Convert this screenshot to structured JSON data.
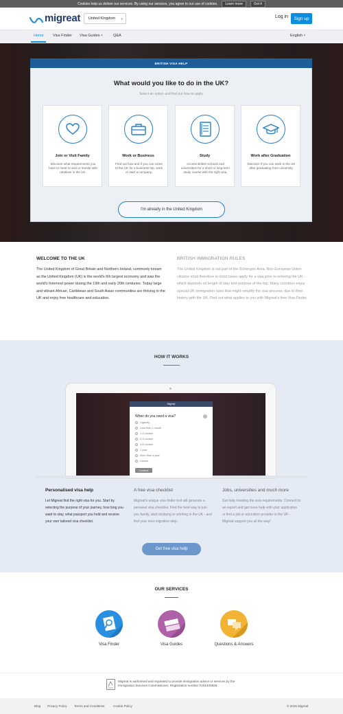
{
  "cookie": {
    "text": "Cookies help us deliver our services. By using our services, you agree to our use of cookies.",
    "learn": "Learn more",
    "gotit": "Got it"
  },
  "header": {
    "logo": "migreat",
    "country": "United Kingdom",
    "login": "Log in",
    "signup": "Sign up"
  },
  "nav": {
    "items": [
      "Home",
      "Visa Finder",
      "Visa Guides",
      "Q&A"
    ],
    "language": "English"
  },
  "hero": {
    "banner": "BRITISH VISA HELP",
    "title": "What would you like to do in the UK?",
    "subtitle": "Select an option and find out how to apply",
    "options": [
      {
        "icon": "heart-icon",
        "title": "Join or Visit Family",
        "desc": "Discover what requirements you have to meet to visit or reunite with relatives in the UK."
      },
      {
        "icon": "briefcase-icon",
        "title": "Work or Business",
        "desc": "Find out how and if you can come to the UK for a business trip, work or start a company."
      },
      {
        "icon": "notebook-icon",
        "title": "Study",
        "desc": "Access British schools and universities for a short or long-term study course with the right visa."
      },
      {
        "icon": "graduation-cap-icon",
        "title": "Work after Graduation",
        "desc": "Discover if you can work in the UK after graduating from university."
      }
    ],
    "already": "I'm already in the United Kingdom"
  },
  "welcome": {
    "title": "WELCOME TO THE UK",
    "text": "The United Kingdom of Great Britain and Northern Ireland, commonly known as the United Kingdom (UK) is the world's 6th largest economy and was the world's foremost power during the 19th and early 20th centuries. Today large and vibrant African, Caribbean and South Asian communities are thriving in the UK and enjoy free healthcare and education."
  },
  "rules": {
    "title": "BRITISH IMMIGRATION RULES",
    "text": "The United Kingdom is not part of the Schengen Area. Non-European Union citizens must therefore in most cases apply for a visa prior to entering the UK -which depends on length of stay and purpose of the trip. Many countries enjoy special UK immigration rules that might simplify the visa process, due to their history with the UK. Find out what applies to you with Migreat's free Visa Finder."
  },
  "how": {
    "title": "HOW IT WORKS",
    "modal": {
      "header": "Migreat",
      "question": "When do you need a visa?",
      "options": [
        "Urgently",
        "Less than 1 month",
        "1-2 months",
        "2-3 months",
        "3-6 months",
        "1 year",
        "More than a year",
        "Unsure"
      ],
      "button": "Continue"
    },
    "columns": [
      {
        "title": "Personalised visa help",
        "text": "Let Migreat find the right visa for you. Start by selecting the purpose of your journey, how long you want to stay, what passport you hold and receive your own tailored visa checklist."
      },
      {
        "title": "A free visa checklist",
        "text": "Migreat's unique visa finder tool will generate a personal visa checklist. Find the best way to join you family, start studying or working in the UK - and find your next migration step."
      },
      {
        "title": "Jobs, universities and much more",
        "text": "Get help meeting the visa requirements. Connect to an expert and get more help with your application or find a job or education provider in the UK - Migreat support you all the way!"
      }
    ],
    "button": "Get free visa help"
  },
  "services": {
    "title": "OUR SERVICES",
    "items": [
      {
        "label": "Visa Finder",
        "color": "#2a8fe0"
      },
      {
        "label": "Visa Guides",
        "color": "#b060a8"
      },
      {
        "label": "Questions & Answers",
        "color": "#f2b233"
      }
    ]
  },
  "regulation": {
    "text": "Migreat is authorised and regulated to provide immigration advice or services by the Immigration Services Commissioner, Registration number F201400828."
  },
  "footer": {
    "links": [
      "Blog",
      "Privacy Policy",
      "Terms and Conditions",
      "Cookie Policy"
    ],
    "copyright": "© 2015 Migreat"
  }
}
